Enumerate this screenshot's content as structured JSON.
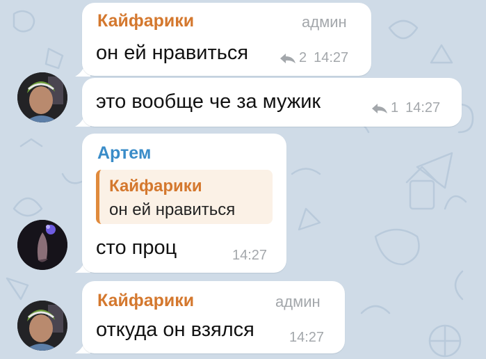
{
  "messages": [
    {
      "sender": "Кайфарики",
      "badge": "админ",
      "text": "он ей нравиться",
      "replies": "2",
      "time": "14:27"
    },
    {
      "text": "это вообще че за мужик",
      "replies": "1",
      "time": "14:27"
    },
    {
      "sender": "Артем",
      "quote": {
        "sender": "Кайфарики",
        "text": "он ей нравиться"
      },
      "text": "сто проц",
      "time": "14:27"
    },
    {
      "sender": "Кайфарики",
      "badge": "админ",
      "text": "откуда он взялся",
      "time": "14:27"
    }
  ],
  "colors": {
    "background": "#cfdbe7",
    "bubble": "#ffffff",
    "sender_orange": "#d4782e",
    "sender_blue": "#3a8cc8",
    "meta_gray": "#a3a7ab",
    "quote_bg": "#fbf1e6"
  },
  "icons": [
    "reply-arrow-icon",
    "avatar-kaifariki",
    "avatar-artem"
  ]
}
